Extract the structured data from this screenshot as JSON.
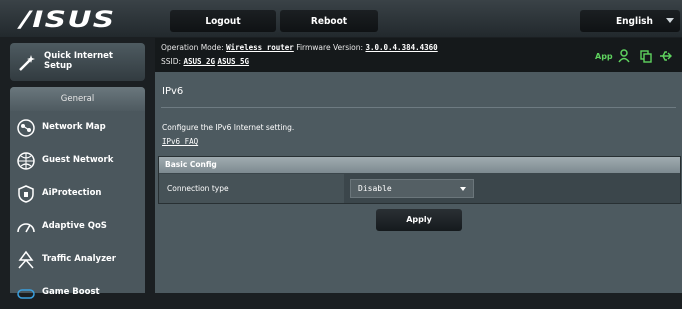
{
  "brand": {
    "logo_text": "/ISUS"
  },
  "topbar": {
    "logout_label": "Logout",
    "reboot_label": "Reboot",
    "language": "English"
  },
  "info": {
    "op_mode_label": "Operation Mode:",
    "op_mode_value": "Wireless router",
    "firmware_label": "Firmware Version:",
    "firmware_value": "3.0.0.4.384.4360",
    "ssid_label": "SSID:",
    "ssid_1": "ASUS_2G",
    "ssid_2": "ASUS_5G",
    "app_label": "App"
  },
  "sidebar": {
    "qis_label": "Quick Internet Setup",
    "section_label": "General",
    "items": [
      {
        "label": "Network Map",
        "icon": "network-map-icon"
      },
      {
        "label": "Guest Network",
        "icon": "guest-network-icon"
      },
      {
        "label": "AiProtection",
        "icon": "shield-icon"
      },
      {
        "label": "Adaptive QoS",
        "icon": "speedometer-icon"
      },
      {
        "label": "Traffic Analyzer",
        "icon": "traffic-analyzer-icon"
      },
      {
        "label": "Game Boost",
        "icon": "game-boost-icon"
      }
    ]
  },
  "main": {
    "title": "IPv6",
    "description": "Configure the IPv6 Internet setting.",
    "faq_link": "IPv6 FAQ",
    "section_title": "Basic Config",
    "connection_type_label": "Connection type",
    "connection_type_value": "Disable",
    "apply_label": "Apply"
  },
  "colors": {
    "accent_green": "#5fd35f",
    "panel": "#4d5a60",
    "background": "#1b1f22"
  }
}
